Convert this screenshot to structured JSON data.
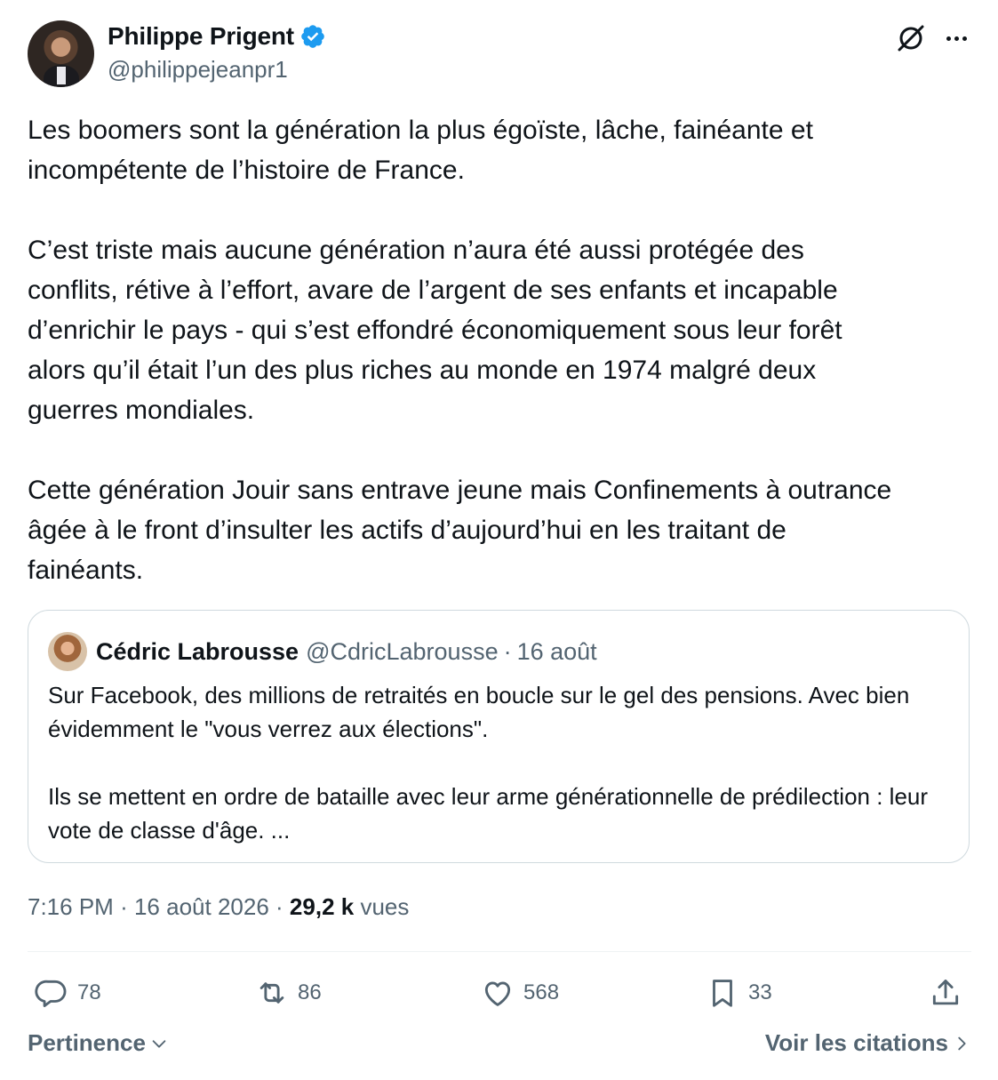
{
  "author": {
    "display_name": "Philippe Prigent",
    "handle": "@philippejeanpr1",
    "verified": true,
    "verified_color": "#1d9bf0"
  },
  "header_icons": [
    "grok-icon",
    "more-icon"
  ],
  "tweet": {
    "paragraphs": [
      "Les boomers sont la génération la plus égoïste, lâche, fainéante et\nincompétente de l’histoire de France.",
      "C’est triste mais aucune génération n’aura été aussi protégée des\nconflits, rétive à l’effort, avare de l’argent de ses enfants et incapable\nd’enrichir le pays - qui s’est effondré économiquement sous leur forêt\nalors qu’il était l’un des plus riches au monde en 1974 malgré deux\nguerres mondiales.",
      "Cette génération Jouir sans entrave jeune mais Confinements à outrance\nâgée à le front d’insulter les actifs d’aujourd’hui en les traitant de\nfainéants."
    ]
  },
  "quote": {
    "display_name": "Cédric Labrousse",
    "handle": "@CdricLabrousse",
    "separator": "·",
    "date": "16 août",
    "paragraphs": [
      "Sur Facebook, des millions de retraités en boucle sur le gel des pensions. Avec bien évidemment le \"vous verrez aux élections\".",
      "Ils se mettent en ordre de bataille avec leur arme générationnelle de prédilection : leur vote de classe d'âge. ..."
    ]
  },
  "meta": {
    "time": "7:16 PM",
    "separator": "·",
    "date": "16 août 2026",
    "views_count": "29,2 k",
    "views_label": "vues"
  },
  "actions": {
    "replies": "78",
    "reposts": "86",
    "likes": "568",
    "bookmarks": "33"
  },
  "footer": {
    "sort_label": "Pertinence",
    "quotes_label": "Voir les citations"
  },
  "colors": {
    "text": "#0f1419",
    "secondary": "#536471",
    "border": "#cfd9de"
  }
}
